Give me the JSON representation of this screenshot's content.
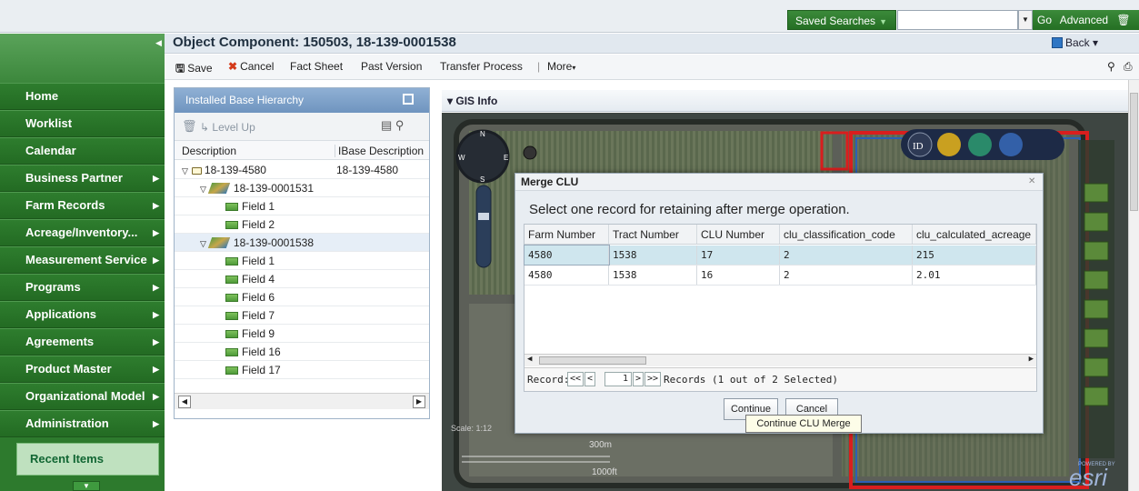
{
  "topbar": {
    "saved_searches": "Saved Searches",
    "search_value": "",
    "go_label": "Go",
    "advanced_label": "Advanced"
  },
  "nav": {
    "items": [
      {
        "label": "Home",
        "has_arrow": false
      },
      {
        "label": "Worklist",
        "has_arrow": false
      },
      {
        "label": "Calendar",
        "has_arrow": false
      },
      {
        "label": "Business Partner",
        "has_arrow": true
      },
      {
        "label": "Farm Records",
        "has_arrow": true
      },
      {
        "label": "Acreage/Inventory...",
        "has_arrow": true
      },
      {
        "label": "Measurement Service",
        "has_arrow": true
      },
      {
        "label": "Programs",
        "has_arrow": true
      },
      {
        "label": "Applications",
        "has_arrow": true
      },
      {
        "label": "Agreements",
        "has_arrow": true
      },
      {
        "label": "Product Master",
        "has_arrow": true
      },
      {
        "label": "Organizational Model",
        "has_arrow": true
      },
      {
        "label": "Administration",
        "has_arrow": true
      }
    ],
    "recent_items": "Recent Items"
  },
  "header": {
    "title": "Object Component: 150503, 18-139-0001538",
    "back_label": "Back"
  },
  "toolbar": {
    "save": "Save",
    "cancel": "Cancel",
    "fact_sheet": "Fact Sheet",
    "past_version": "Past Version",
    "transfer_process": "Transfer Process",
    "more": "More"
  },
  "ibase": {
    "title": "Installed Base Hierarchy",
    "level_up": "Level Up",
    "col_description": "Description",
    "col_ibase_description": "IBase Description",
    "rows": [
      {
        "label": "18-139-4580",
        "ibase": "18-139-4580",
        "type": "folder",
        "depth": 0
      },
      {
        "label": "18-139-0001531",
        "ibase": "",
        "type": "layer",
        "depth": 1
      },
      {
        "label": "Field 1",
        "ibase": "",
        "type": "field",
        "depth": 2
      },
      {
        "label": "Field 2",
        "ibase": "",
        "type": "field",
        "depth": 2
      },
      {
        "label": "18-139-0001538",
        "ibase": "",
        "type": "layer",
        "depth": 1,
        "selected": true
      },
      {
        "label": "Field 1",
        "ibase": "",
        "type": "field",
        "depth": 2
      },
      {
        "label": "Field 4",
        "ibase": "",
        "type": "field",
        "depth": 2
      },
      {
        "label": "Field 6",
        "ibase": "",
        "type": "field",
        "depth": 2
      },
      {
        "label": "Field 7",
        "ibase": "",
        "type": "field",
        "depth": 2
      },
      {
        "label": "Field 9",
        "ibase": "",
        "type": "field",
        "depth": 2
      },
      {
        "label": "Field 16",
        "ibase": "",
        "type": "field",
        "depth": 2
      },
      {
        "label": "Field 17",
        "ibase": "",
        "type": "field",
        "depth": 2
      }
    ]
  },
  "gis": {
    "title": "GIS Info",
    "scale_label": "Scale: 1:12",
    "scale_300m": "300m",
    "scale_1000ft": "1000ft",
    "id_button": "ID",
    "esri_label": "esri",
    "powered_by": "POWERED BY",
    "compass_n": "N",
    "compass_s": "S",
    "compass_e": "E",
    "compass_w": "W"
  },
  "dialog": {
    "title": "Merge CLU",
    "prompt": "Select one record for retaining after merge operation.",
    "columns": [
      "Farm Number",
      "Tract Number",
      "CLU Number",
      "clu_classification_code",
      "clu_calculated_acreage"
    ],
    "rows": [
      [
        "4580",
        "1538",
        "17",
        "2",
        "215"
      ],
      [
        "4580",
        "1538",
        "16",
        "2",
        "2.01"
      ]
    ],
    "record_label": "Record:",
    "record_value": "1",
    "records_status": "Records (1 out of 2 Selected)",
    "continue": "Continue",
    "cancel": "Cancel",
    "tooltip": "Continue CLU Merge"
  },
  "colors": {
    "nav_green": "#2d7a2d",
    "header_blue": "#7a9cc6",
    "field_border_red": "#d91e1e",
    "selected_row": "#cfe6ee"
  }
}
